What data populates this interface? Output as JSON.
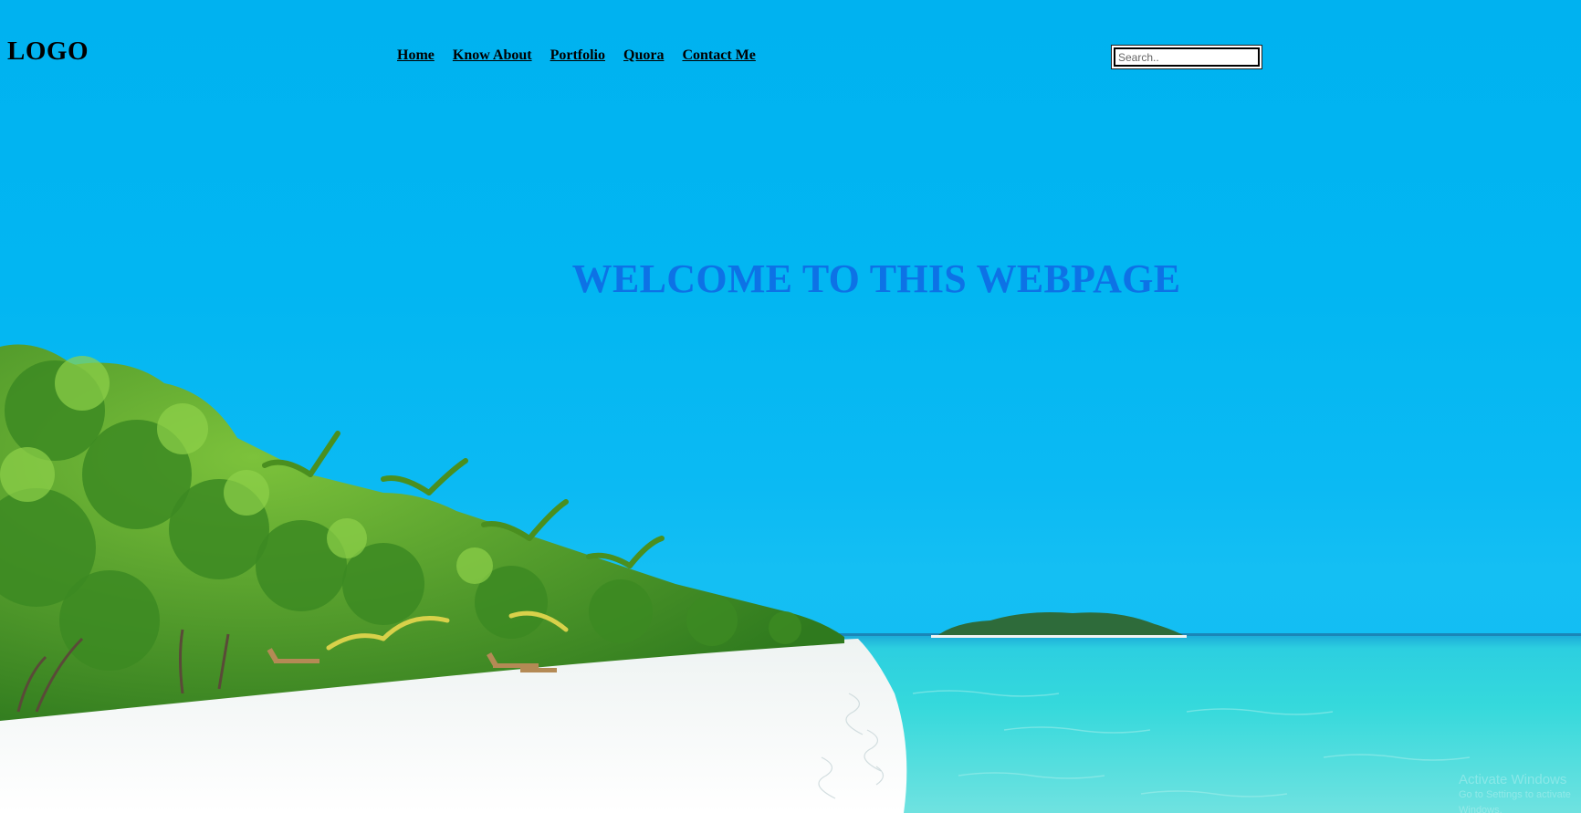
{
  "header": {
    "logo": "LOGO",
    "search_placeholder": "Search.."
  },
  "nav": {
    "items": [
      {
        "label": "Home"
      },
      {
        "label": "Know About"
      },
      {
        "label": "Portfolio"
      },
      {
        "label": "Quora"
      },
      {
        "label": "Contact Me"
      }
    ]
  },
  "hero": {
    "heading": "WELCOME TO THIS WEBPAGE",
    "heading_color": "#0d72e6",
    "background": "tropical-beach-image"
  },
  "watermark": {
    "line1": "Activate Windows",
    "line2": "Go to Settings to activate Windows."
  }
}
